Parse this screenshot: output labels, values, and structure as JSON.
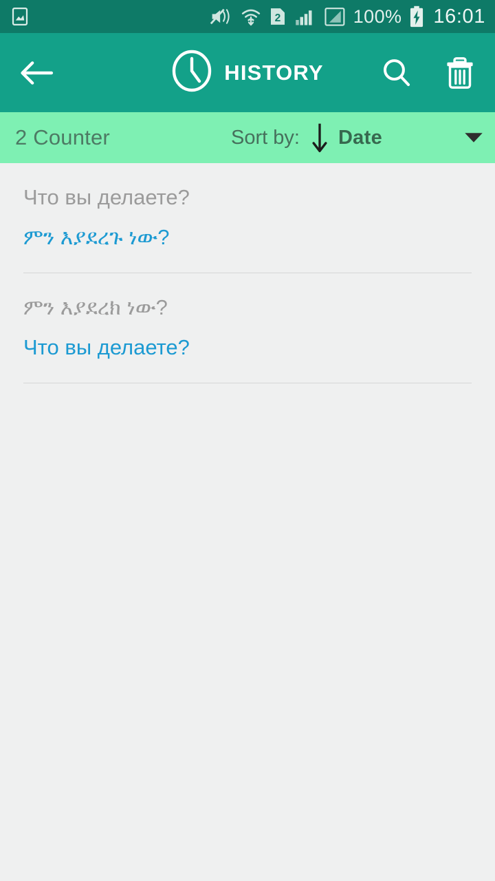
{
  "status_bar": {
    "icons": [
      {
        "name": "screenshot-icon",
        "glyph": "image-in-frame"
      },
      {
        "name": "sound-mute-vibrate-icon",
        "glyph": "speaker-muted"
      },
      {
        "name": "wifi-data-transfer-icon",
        "glyph": "wifi-arrows"
      },
      {
        "name": "sim-two-icon",
        "glyph": "2"
      },
      {
        "name": "signal-bars-sim1-icon",
        "glyph": "bars"
      },
      {
        "name": "signal-bars-sim2-icon",
        "glyph": "bars-boxed"
      }
    ],
    "sim_badge": "2",
    "battery_percent": "100%",
    "battery_state": "charging",
    "time": "16:01"
  },
  "app_bar": {
    "back_label": "Back",
    "clock_icon": "clock-icon",
    "title": "HISTORY",
    "search_label": "Search",
    "delete_label": "Delete all"
  },
  "sort_bar": {
    "counter": "2 Counter",
    "sort_by_label": "Sort by:",
    "direction": "descending",
    "sort_value": "Date",
    "dropdown_label": "Open sort menu"
  },
  "history": {
    "items": [
      {
        "source": "Что вы делаете?",
        "target": "ምን እያደረጉ ነው?"
      },
      {
        "source": "ምን እያደረክ ነው?",
        "target": "Что вы делаете?"
      }
    ]
  },
  "colors": {
    "status_bar": "#0e7a67",
    "app_bar": "#13a189",
    "sort_bar": "#7ef0b3",
    "background": "#eff0f0",
    "source_text": "#9b9b9b",
    "target_text": "#1c9ad2",
    "divider": "#d5d6d6"
  }
}
